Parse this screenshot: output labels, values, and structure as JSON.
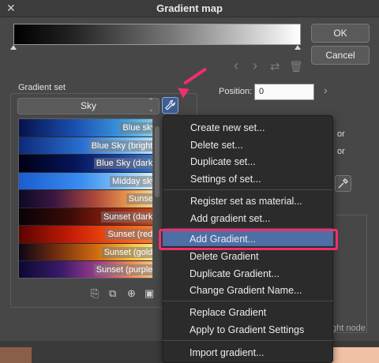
{
  "window": {
    "title": "Gradient map"
  },
  "buttons": {
    "ok": "OK",
    "cancel": "Cancel"
  },
  "gradient_set": {
    "label": "Gradient set",
    "selected": "Sky",
    "items": [
      {
        "label": "Blue sky",
        "gradient": "linear-gradient(to right,#08124a,#1a4fb0 40%,#3d9be0 75%,#8fd6f0)"
      },
      {
        "label": "Blue Sky (bright)",
        "gradient": "linear-gradient(to right,#0d2a78,#2a6fd0 45%,#6fb6ee 75%,#cfeafa)"
      },
      {
        "label": "Blue Sky (dark)",
        "gradient": "linear-gradient(to right,#000014,#05165a 40%,#1a3f9e 70%,#3a7ad0)"
      },
      {
        "label": "Midday sky",
        "gradient": "linear-gradient(to right,#1a5cd0,#3a8ef0 45%,#8ac8f8 75%,#e8f6ff)"
      },
      {
        "label": "Sunset",
        "gradient": "linear-gradient(to right,#0b0a24,#3a1640 25%,#b04a3a 55%,#f0a050 80%,#f8e0a0)"
      },
      {
        "label": "Sunset (dark)",
        "gradient": "linear-gradient(to right,#080208,#3a0a08 35%,#8a1e0c 65%,#d04a18)"
      },
      {
        "label": "Sunset (red)",
        "gradient": "linear-gradient(to right,#5a0400,#c01a06 35%,#f04a10 65%,#ff8030)"
      },
      {
        "label": "Sunset (gold)",
        "gradient": "linear-gradient(to right,#0a0614,#6a2a10 25%,#d06a10 55%,#f8c040 80%,#fff0a0)"
      },
      {
        "label": "Sunset (purple)",
        "gradient": "linear-gradient(to right,#0c0830,#3a1a6a 30%,#9a3a8a 55%,#f08a5a 80%,#f8d090)"
      }
    ]
  },
  "position": {
    "label": "Position:",
    "value": "0"
  },
  "partial_labels": {
    "or1": "or",
    "or2": "or",
    "right_node": "ght node"
  },
  "context_menu": {
    "items": [
      "Create new set...",
      "Delete set...",
      "Duplicate set...",
      "Settings of set...",
      "Register set as material...",
      "Add gradient set...",
      "Add Gradient...",
      "Delete Gradient",
      "Duplicate Gradient...",
      "Change Gradient Name...",
      "Replace Gradient",
      "Apply to Gradient Settings",
      "Import gradient..."
    ],
    "highlighted": "Add Gradient..."
  },
  "colors": {
    "accent": "#ee2f6f",
    "highlight": "#4d6fa6"
  }
}
